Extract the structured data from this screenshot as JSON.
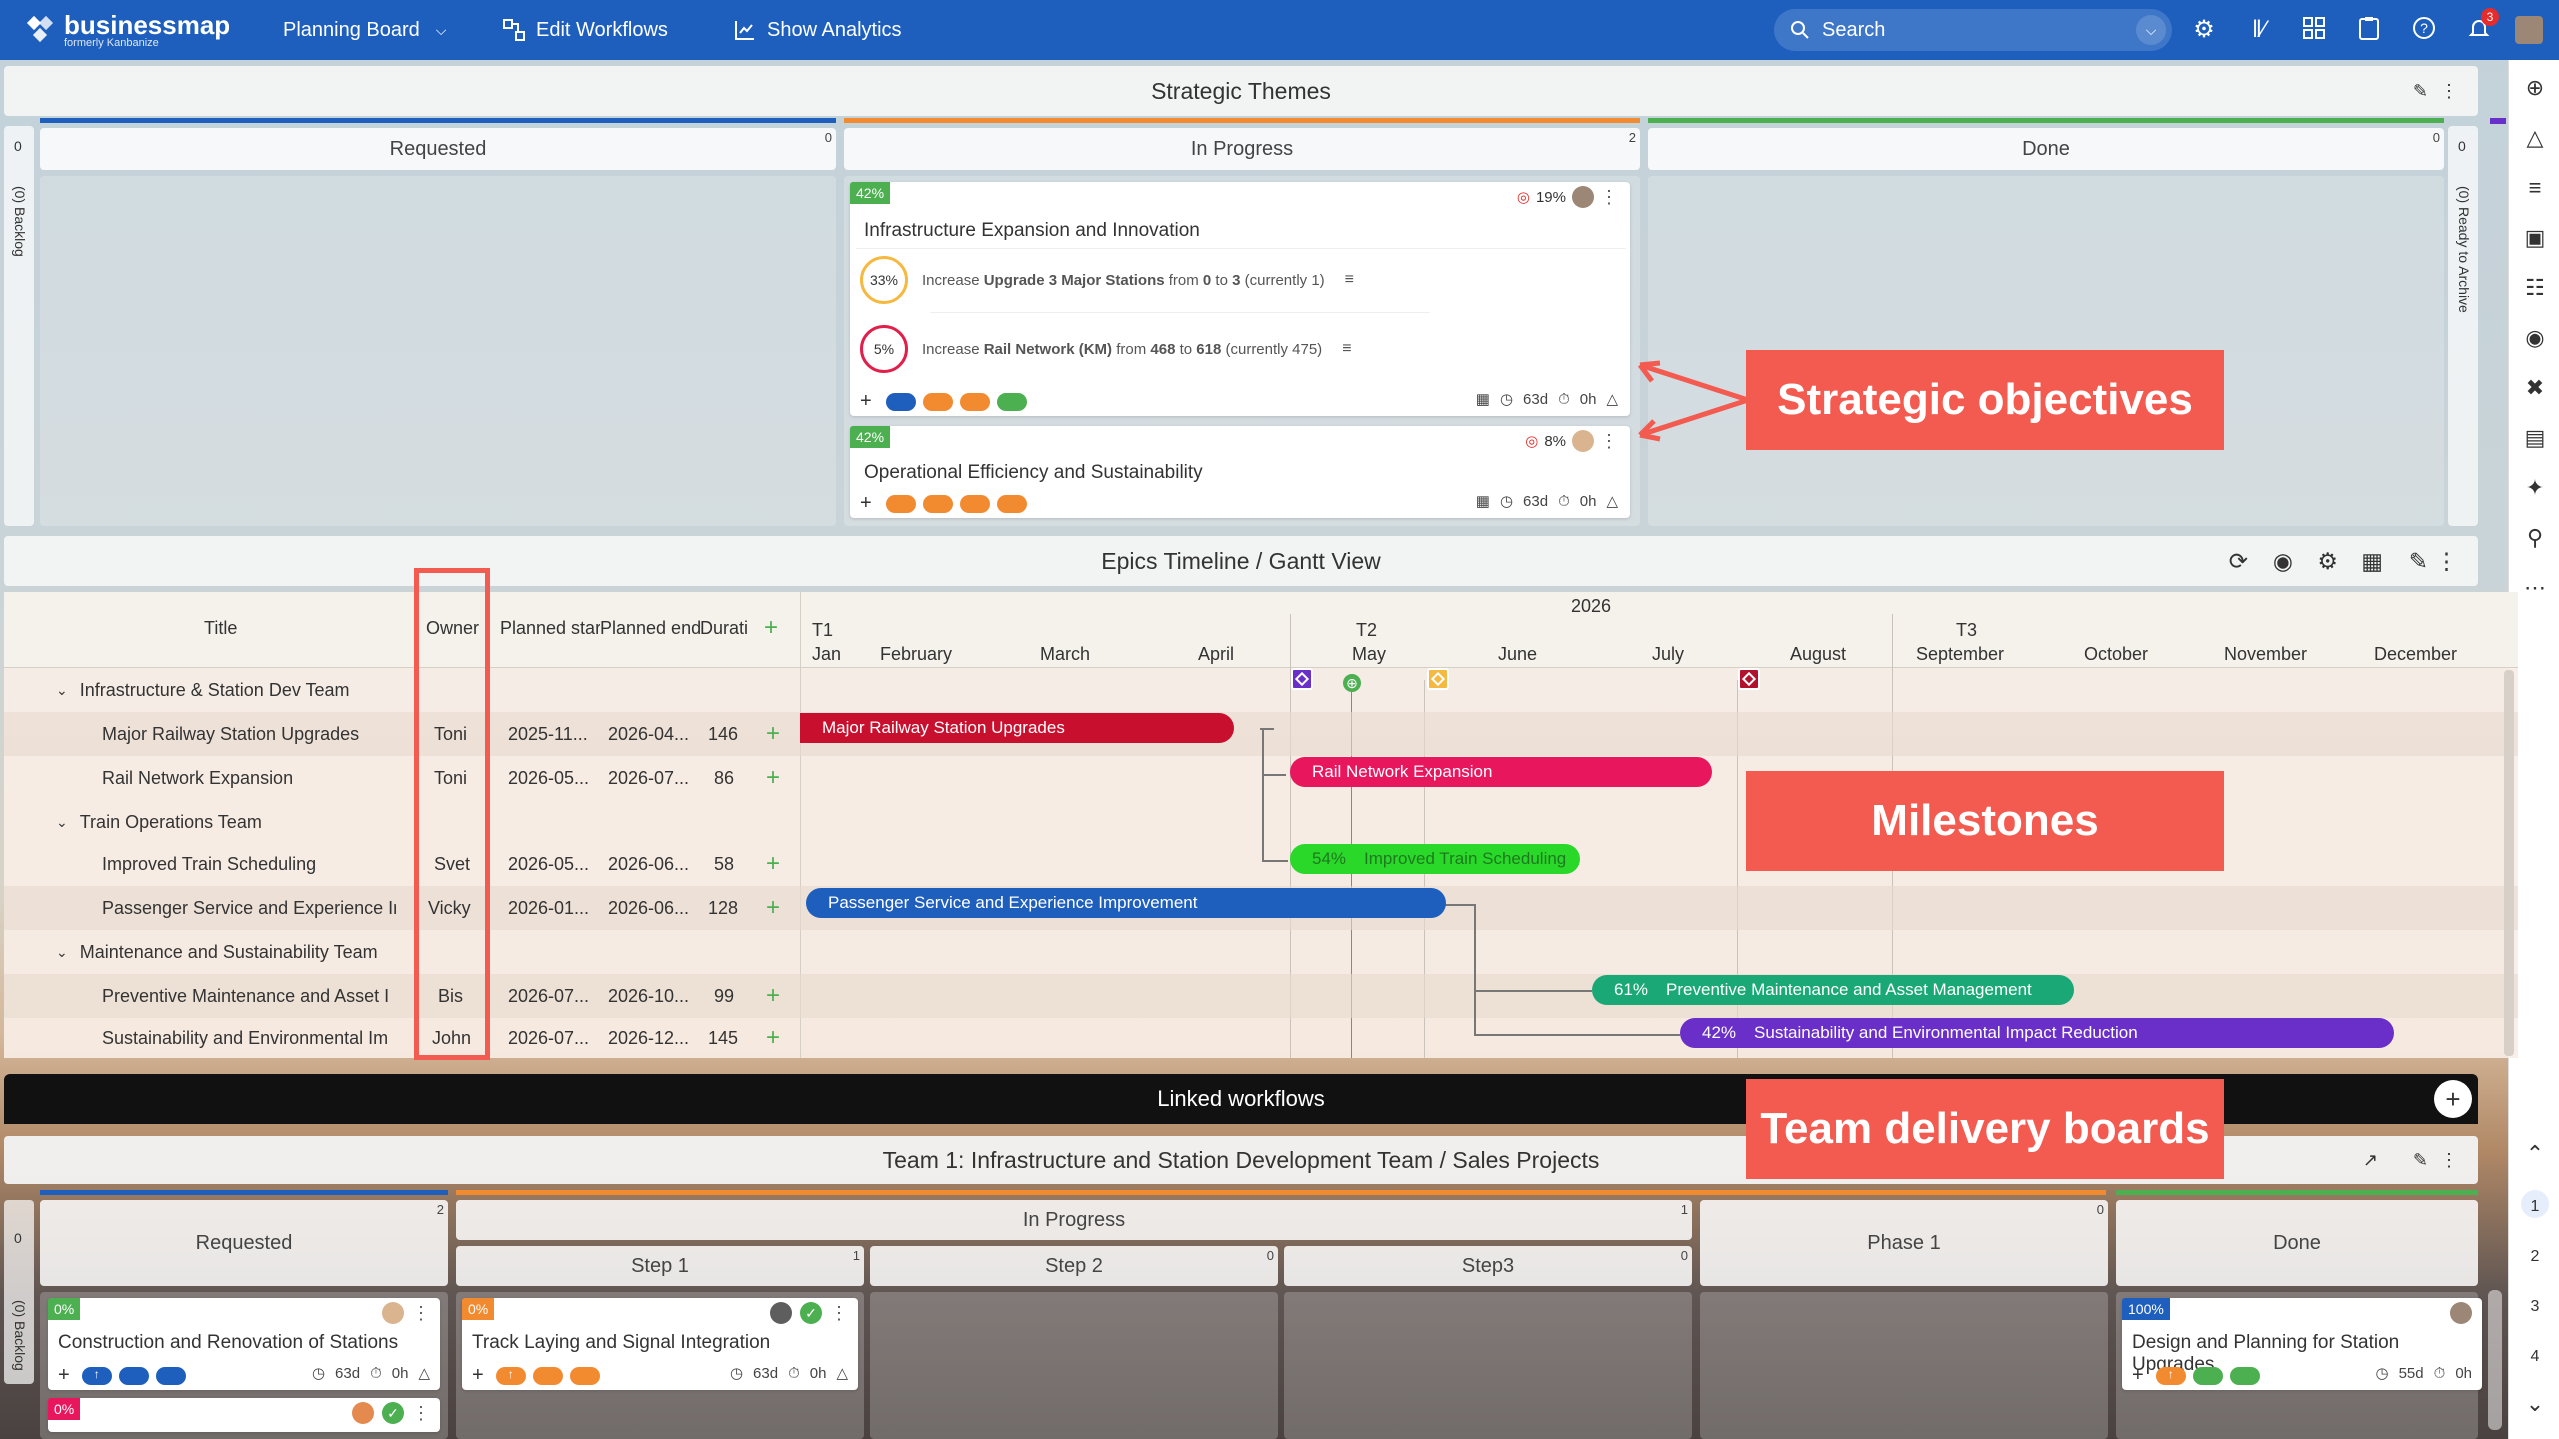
{
  "topbar": {
    "logo": "businessmap",
    "logo_sub": "formerly Kanbanize",
    "planning_board": "Planning Board",
    "edit_workflows": "Edit Workflows",
    "show_analytics": "Show Analytics",
    "search_placeholder": "Search",
    "notif_count": "3",
    "colors": {
      "bar": "#1e5fbe"
    }
  },
  "strategic": {
    "title": "Strategic Themes",
    "columns": [
      {
        "label": "Requested",
        "count": "0"
      },
      {
        "label": "In Progress",
        "count": "2"
      },
      {
        "label": "Done",
        "count": "0"
      }
    ],
    "backlog_label": "(0) Backlog",
    "archive_label": "(0) Ready to Archive",
    "left_tab": "0",
    "right_tab": "0",
    "cards": [
      {
        "pct": "42%",
        "title": "Infrastructure Expansion and Innovation",
        "target": "19%",
        "objectives": [
          {
            "pct": "33%",
            "pre": "Increase ",
            "bold": "Upgrade 3 Major Stations",
            "mid": " from ",
            "from": "0",
            "to_word": " to ",
            "to": "3",
            "current": " (currently 1)"
          },
          {
            "pct": "5%",
            "pre": "Increase ",
            "bold": "Rail Network (KM)",
            "mid": " from ",
            "from": "468",
            "to_word": " to ",
            "to": "618",
            "current": " (currently 475)"
          }
        ],
        "days": "63d",
        "hours": "0h"
      },
      {
        "pct": "42%",
        "title": "Operational Efficiency and Sustainability",
        "target": "8%",
        "days": "63d",
        "hours": "0h"
      }
    ]
  },
  "callouts": {
    "objectives": "Strategic objectives",
    "milestones": "Milestones",
    "team_boards": "Team delivery boards"
  },
  "gantt": {
    "title": "Epics Timeline / Gantt View",
    "headers": {
      "title": "Title",
      "owner": "Owner",
      "start": "Planned star",
      "end": "Planned end",
      "duration": "Durati"
    },
    "year": "2026",
    "quarters": [
      "T1",
      "T2",
      "T3"
    ],
    "months": [
      "Jan",
      "February",
      "March",
      "April",
      "May",
      "June",
      "July",
      "August",
      "September",
      "October",
      "November",
      "December"
    ],
    "groups": [
      {
        "name": "Infrastructure & Station Dev Team"
      },
      {
        "name": "Train Operations Team"
      },
      {
        "name": "Maintenance and Sustainability Team"
      }
    ],
    "rows": [
      {
        "title": "Major Railway Station Upgrades",
        "owner": "Toni",
        "start": "2025-11...",
        "end": "2026-04...",
        "duration": "146",
        "bar": "Major Railway Station Upgrades",
        "pct": ""
      },
      {
        "title": "Rail Network Expansion",
        "owner": "Toni",
        "start": "2026-05...",
        "end": "2026-07...",
        "duration": "86",
        "bar": "Rail Network Expansion",
        "pct": ""
      },
      {
        "title": "Improved Train Scheduling",
        "owner": "Svet",
        "start": "2026-05...",
        "end": "2026-06...",
        "duration": "58",
        "bar": "Improved Train Scheduling",
        "pct": "54%"
      },
      {
        "title": "Passenger Service and Experience Ir",
        "owner": "Vicky",
        "start": "2026-01...",
        "end": "2026-06...",
        "duration": "128",
        "bar": "Passenger Service and Experience Improvement",
        "pct": ""
      },
      {
        "title": "Preventive Maintenance and Asset I",
        "owner": "Bis",
        "start": "2026-07...",
        "end": "2026-10...",
        "duration": "99",
        "bar": "Preventive Maintenance and Asset Management",
        "pct": "61%"
      },
      {
        "title": "Sustainability and Environmental Im",
        "owner": "John",
        "start": "2026-07...",
        "end": "2026-12...",
        "duration": "145",
        "bar": "Sustainability and Environmental Impact Reduction",
        "pct": "42%"
      }
    ],
    "colors": {
      "red": "#c8102e",
      "pink": "#e8175d",
      "green": "#29d829",
      "blue": "#1e5fbe",
      "teal": "#1aa876",
      "purple": "#6a2fc9"
    }
  },
  "linked": {
    "title": "Linked workflows",
    "board_title": "Team 1: Infrastructure and Station Development Team / Sales Projects",
    "columns": [
      {
        "label": "Requested",
        "count": "2"
      },
      {
        "label": "In Progress",
        "count": "1"
      },
      {
        "label": "Phase 1",
        "count": "0"
      },
      {
        "label": "Done",
        "count": ""
      }
    ],
    "steps": [
      {
        "label": "Step 1",
        "count": "1"
      },
      {
        "label": "Step 2",
        "count": "0"
      },
      {
        "label": "Step3",
        "count": "0"
      }
    ],
    "backlog_label": "(0) Backlog",
    "left_tab": "0",
    "cards": [
      {
        "pct": "0%",
        "title": "Construction and Renovation of Stations",
        "days": "63d",
        "hours": "0h"
      },
      {
        "pct": "0%",
        "title": "Track Laying and Signal Integration",
        "days": "63d",
        "hours": "0h"
      },
      {
        "pct": "100%",
        "title": "Design and Planning for Station Upgrades",
        "days": "55d",
        "hours": "0h"
      },
      {
        "pct": "0%"
      }
    ]
  },
  "rsidebar_steps": [
    "1",
    "2",
    "3",
    "4"
  ]
}
